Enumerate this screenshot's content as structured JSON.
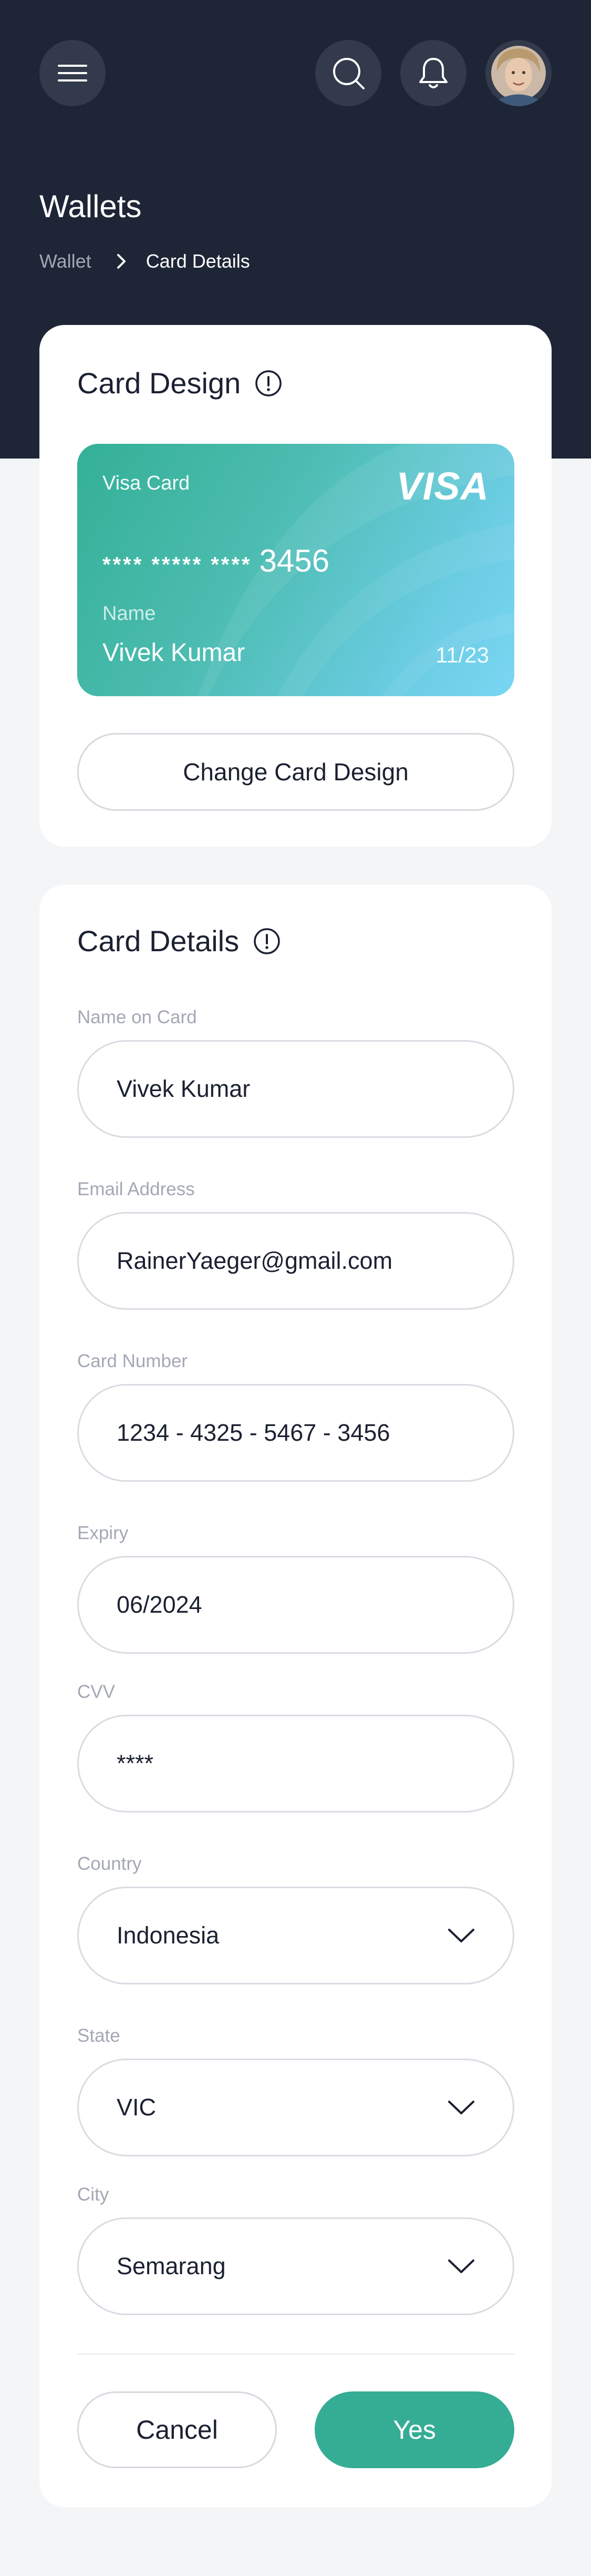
{
  "header": {
    "title": "Wallets",
    "breadcrumb": [
      "Wallet",
      "Card Details"
    ]
  },
  "icons": {
    "menu": "hamburger-menu-icon",
    "search": "search-icon",
    "notifications": "bell-icon",
    "avatar": "user-avatar",
    "breadcrumb_separator": "chevron-right-icon",
    "info": "info-icon",
    "dropdown": "chevron-down-icon"
  },
  "card_design": {
    "title": "Card Design",
    "card": {
      "type": "Visa Card",
      "brand": "VISA",
      "masked_number": "**** ***** ****",
      "last_digits": "3456",
      "name_label": "Name",
      "name": "Vivek Kumar",
      "expiry": "11/23"
    },
    "change_button": "Change Card Design"
  },
  "card_details": {
    "title": "Card Details",
    "fields": {
      "name": {
        "label": "Name on Card",
        "value": "Vivek Kumar"
      },
      "email": {
        "label": "Email Address",
        "value": "RainerYaeger@gmail.com"
      },
      "number": {
        "label": "Card Number",
        "value": "1234 - 4325 - 5467 - 3456"
      },
      "expiry": {
        "label": "Expiry",
        "value": "06/2024"
      },
      "cvv": {
        "label": "CVV",
        "value": "****"
      },
      "country": {
        "label": "Country",
        "value": "Indonesia"
      },
      "state": {
        "label": "State",
        "value": "VIC"
      },
      "city": {
        "label": "City",
        "value": "Semarang"
      }
    },
    "cancel_button": "Cancel",
    "confirm_button": "Yes"
  },
  "colors": {
    "header_bg": "#1e2536",
    "accent": "#35ad94",
    "card_gradient_start": "#34b097",
    "card_gradient_end": "#7ad6f3"
  }
}
